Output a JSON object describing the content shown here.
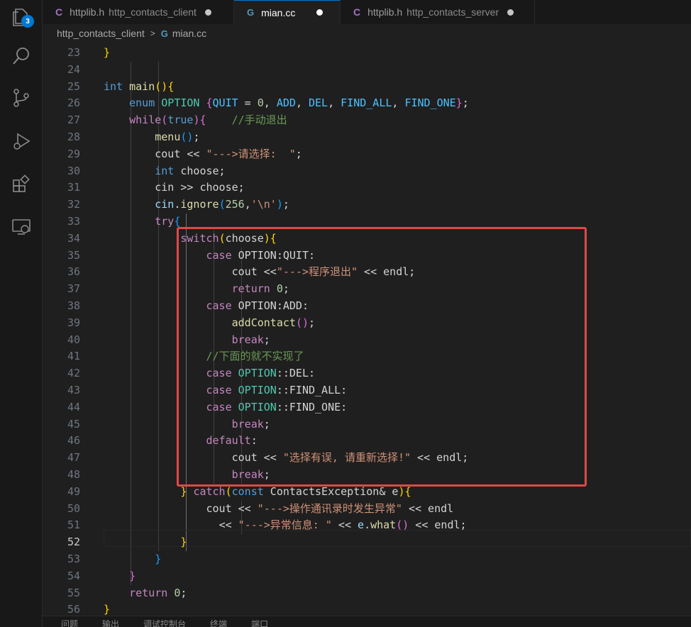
{
  "activity_bar": {
    "items": [
      {
        "name": "explorer-icon",
        "badge": "3"
      },
      {
        "name": "search-icon"
      },
      {
        "name": "source-control-icon"
      },
      {
        "name": "run-debug-icon"
      },
      {
        "name": "extensions-icon"
      },
      {
        "name": "remote-explorer-icon"
      }
    ]
  },
  "tabs": [
    {
      "icon": "C",
      "label": "httplib.h",
      "description": "http_contacts_client",
      "active": false
    },
    {
      "icon": "G",
      "label": "mian.cc",
      "description": "",
      "active": true
    },
    {
      "icon": "C",
      "label": "httplib.h",
      "description": "http_contacts_server",
      "active": false
    }
  ],
  "breadcrumb": {
    "folder": "http_contacts_client",
    "separator": ">",
    "file_icon": "G",
    "file": "mian.cc"
  },
  "editor": {
    "active_line": "52",
    "lines": [
      {
        "n": "23",
        "tokens": [
          {
            "t": "}",
            "c": "b1"
          }
        ]
      },
      {
        "n": "24",
        "tokens": []
      },
      {
        "n": "25",
        "tokens": [
          {
            "t": "int",
            "c": "kw"
          },
          {
            "t": " ",
            "c": "plain"
          },
          {
            "t": "main",
            "c": "fn"
          },
          {
            "t": "(){",
            "c": "b1"
          }
        ]
      },
      {
        "n": "26",
        "tokens": [
          {
            "t": "    ",
            "c": "plain"
          },
          {
            "t": "enum",
            "c": "kw"
          },
          {
            "t": " ",
            "c": "plain"
          },
          {
            "t": "OPTION",
            "c": "ty"
          },
          {
            "t": " ",
            "c": "plain"
          },
          {
            "t": "{",
            "c": "b2"
          },
          {
            "t": "QUIT",
            "c": "enumv"
          },
          {
            "t": " = ",
            "c": "plain"
          },
          {
            "t": "0",
            "c": "num"
          },
          {
            "t": ", ",
            "c": "plain"
          },
          {
            "t": "ADD",
            "c": "enumv"
          },
          {
            "t": ", ",
            "c": "plain"
          },
          {
            "t": "DEL",
            "c": "enumv"
          },
          {
            "t": ", ",
            "c": "plain"
          },
          {
            "t": "FIND_ALL",
            "c": "enumv"
          },
          {
            "t": ", ",
            "c": "plain"
          },
          {
            "t": "FIND_ONE",
            "c": "enumv"
          },
          {
            "t": "}",
            "c": "b2"
          },
          {
            "t": ";",
            "c": "plain"
          }
        ]
      },
      {
        "n": "27",
        "tokens": [
          {
            "t": "    ",
            "c": "plain"
          },
          {
            "t": "while",
            "c": "kwc"
          },
          {
            "t": "(",
            "c": "b2"
          },
          {
            "t": "true",
            "c": "kw"
          },
          {
            "t": "){",
            "c": "b2"
          },
          {
            "t": "    ",
            "c": "plain"
          },
          {
            "t": "//手动退出",
            "c": "cm"
          }
        ]
      },
      {
        "n": "28",
        "tokens": [
          {
            "t": "        ",
            "c": "plain"
          },
          {
            "t": "menu",
            "c": "fn"
          },
          {
            "t": "()",
            "c": "b3"
          },
          {
            "t": ";",
            "c": "plain"
          }
        ]
      },
      {
        "n": "29",
        "tokens": [
          {
            "t": "        ",
            "c": "plain"
          },
          {
            "t": "cout",
            "c": "plain"
          },
          {
            "t": " << ",
            "c": "plain"
          },
          {
            "t": "\"--->请选择:  \"",
            "c": "str"
          },
          {
            "t": ";",
            "c": "plain"
          }
        ]
      },
      {
        "n": "30",
        "tokens": [
          {
            "t": "        ",
            "c": "plain"
          },
          {
            "t": "int",
            "c": "kw"
          },
          {
            "t": " choose;",
            "c": "plain"
          }
        ]
      },
      {
        "n": "31",
        "tokens": [
          {
            "t": "        ",
            "c": "plain"
          },
          {
            "t": "cin >> choose;",
            "c": "plain"
          }
        ]
      },
      {
        "n": "32",
        "tokens": [
          {
            "t": "        ",
            "c": "plain"
          },
          {
            "t": "cin",
            "c": "var"
          },
          {
            "t": ".",
            "c": "plain"
          },
          {
            "t": "ignore",
            "c": "fn"
          },
          {
            "t": "(",
            "c": "b3"
          },
          {
            "t": "256",
            "c": "num"
          },
          {
            "t": ",",
            "c": "plain"
          },
          {
            "t": "'\\n'",
            "c": "str"
          },
          {
            "t": ")",
            "c": "b3"
          },
          {
            "t": ";",
            "c": "plain"
          }
        ]
      },
      {
        "n": "33",
        "tokens": [
          {
            "t": "        ",
            "c": "plain"
          },
          {
            "t": "try",
            "c": "kwc"
          },
          {
            "t": "{",
            "c": "b3"
          }
        ]
      },
      {
        "n": "34",
        "tokens": [
          {
            "t": "            ",
            "c": "plain"
          },
          {
            "t": "switch",
            "c": "kwc"
          },
          {
            "t": "(",
            "c": "b1"
          },
          {
            "t": "choose",
            "c": "plain"
          },
          {
            "t": "){",
            "c": "b1"
          }
        ]
      },
      {
        "n": "35",
        "tokens": [
          {
            "t": "                ",
            "c": "plain"
          },
          {
            "t": "case",
            "c": "kwc"
          },
          {
            "t": " OPTION:QUIT:",
            "c": "plain"
          }
        ]
      },
      {
        "n": "36",
        "tokens": [
          {
            "t": "                    ",
            "c": "plain"
          },
          {
            "t": "cout",
            "c": "plain"
          },
          {
            "t": " <<",
            "c": "plain"
          },
          {
            "t": "\"--->程序退出\"",
            "c": "str"
          },
          {
            "t": " << endl;",
            "c": "plain"
          }
        ]
      },
      {
        "n": "37",
        "tokens": [
          {
            "t": "                    ",
            "c": "plain"
          },
          {
            "t": "return",
            "c": "kwc"
          },
          {
            "t": " ",
            "c": "plain"
          },
          {
            "t": "0",
            "c": "num"
          },
          {
            "t": ";",
            "c": "plain"
          }
        ]
      },
      {
        "n": "38",
        "tokens": [
          {
            "t": "                ",
            "c": "plain"
          },
          {
            "t": "case",
            "c": "kwc"
          },
          {
            "t": " OPTION:ADD:",
            "c": "plain"
          }
        ]
      },
      {
        "n": "39",
        "tokens": [
          {
            "t": "                    ",
            "c": "plain"
          },
          {
            "t": "addContact",
            "c": "fn"
          },
          {
            "t": "()",
            "c": "b2"
          },
          {
            "t": ";",
            "c": "plain"
          }
        ]
      },
      {
        "n": "40",
        "tokens": [
          {
            "t": "                    ",
            "c": "plain"
          },
          {
            "t": "break",
            "c": "kwc"
          },
          {
            "t": ";",
            "c": "plain"
          }
        ]
      },
      {
        "n": "41",
        "tokens": [
          {
            "t": "                ",
            "c": "plain"
          },
          {
            "t": "//下面的就不实现了",
            "c": "cm"
          }
        ]
      },
      {
        "n": "42",
        "tokens": [
          {
            "t": "                ",
            "c": "plain"
          },
          {
            "t": "case",
            "c": "kwc"
          },
          {
            "t": " ",
            "c": "plain"
          },
          {
            "t": "OPTION",
            "c": "ty"
          },
          {
            "t": "::DEL:",
            "c": "plain"
          }
        ]
      },
      {
        "n": "43",
        "tokens": [
          {
            "t": "                ",
            "c": "plain"
          },
          {
            "t": "case",
            "c": "kwc"
          },
          {
            "t": " ",
            "c": "plain"
          },
          {
            "t": "OPTION",
            "c": "ty"
          },
          {
            "t": "::FIND_ALL:",
            "c": "plain"
          }
        ]
      },
      {
        "n": "44",
        "tokens": [
          {
            "t": "                ",
            "c": "plain"
          },
          {
            "t": "case",
            "c": "kwc"
          },
          {
            "t": " ",
            "c": "plain"
          },
          {
            "t": "OPTION",
            "c": "ty"
          },
          {
            "t": "::FIND_ONE:",
            "c": "plain"
          }
        ]
      },
      {
        "n": "45",
        "tokens": [
          {
            "t": "                    ",
            "c": "plain"
          },
          {
            "t": "break",
            "c": "kwc"
          },
          {
            "t": ";",
            "c": "plain"
          }
        ]
      },
      {
        "n": "46",
        "tokens": [
          {
            "t": "                ",
            "c": "plain"
          },
          {
            "t": "default",
            "c": "kwc"
          },
          {
            "t": ":",
            "c": "plain"
          }
        ]
      },
      {
        "n": "47",
        "tokens": [
          {
            "t": "                    ",
            "c": "plain"
          },
          {
            "t": "cout",
            "c": "plain"
          },
          {
            "t": " << ",
            "c": "plain"
          },
          {
            "t": "\"选择有误, 请重新选择!\"",
            "c": "str"
          },
          {
            "t": " << endl;",
            "c": "plain"
          }
        ]
      },
      {
        "n": "48",
        "tokens": [
          {
            "t": "                    ",
            "c": "plain"
          },
          {
            "t": "break",
            "c": "kwc"
          },
          {
            "t": ";",
            "c": "plain"
          }
        ]
      },
      {
        "n": "49",
        "tokens": [
          {
            "t": "            ",
            "c": "plain"
          },
          {
            "t": "} ",
            "c": "b1"
          },
          {
            "t": "catch",
            "c": "kwc"
          },
          {
            "t": "(",
            "c": "b1"
          },
          {
            "t": "const",
            "c": "kw"
          },
          {
            "t": " ContactsException& e",
            "c": "plain"
          },
          {
            "t": ")",
            "c": "b1"
          },
          {
            "t": "{",
            "c": "b1"
          }
        ]
      },
      {
        "n": "50",
        "tokens": [
          {
            "t": "                ",
            "c": "plain"
          },
          {
            "t": "cout",
            "c": "plain"
          },
          {
            "t": " << ",
            "c": "plain"
          },
          {
            "t": "\"--->操作通讯录时发生异常\"",
            "c": "str"
          },
          {
            "t": " << endl",
            "c": "plain"
          }
        ]
      },
      {
        "n": "51",
        "tokens": [
          {
            "t": "                  ",
            "c": "plain"
          },
          {
            "t": "<< ",
            "c": "plain"
          },
          {
            "t": "\"--->异常信息: \"",
            "c": "str"
          },
          {
            "t": " << ",
            "c": "plain"
          },
          {
            "t": "e",
            "c": "var"
          },
          {
            "t": ".",
            "c": "plain"
          },
          {
            "t": "what",
            "c": "fn"
          },
          {
            "t": "()",
            "c": "b2"
          },
          {
            "t": " << endl;",
            "c": "plain"
          }
        ]
      },
      {
        "n": "52",
        "tokens": [
          {
            "t": "            ",
            "c": "plain"
          },
          {
            "t": "}",
            "c": "b1"
          }
        ]
      },
      {
        "n": "53",
        "tokens": [
          {
            "t": "        ",
            "c": "plain"
          },
          {
            "t": "}",
            "c": "b3"
          }
        ]
      },
      {
        "n": "54",
        "tokens": [
          {
            "t": "    ",
            "c": "plain"
          },
          {
            "t": "}",
            "c": "b2"
          }
        ]
      },
      {
        "n": "55",
        "tokens": [
          {
            "t": "    ",
            "c": "plain"
          },
          {
            "t": "return",
            "c": "kwc"
          },
          {
            "t": " ",
            "c": "plain"
          },
          {
            "t": "0",
            "c": "num"
          },
          {
            "t": ";",
            "c": "plain"
          }
        ]
      },
      {
        "n": "56",
        "tokens": [
          {
            "t": "}",
            "c": "b1"
          }
        ]
      }
    ]
  },
  "panel_tabs": [
    "问题",
    "输出",
    "调试控制台",
    "终端",
    "端口"
  ],
  "colors": {
    "highlight_box": "#e04848",
    "accent": "#0078d4"
  }
}
